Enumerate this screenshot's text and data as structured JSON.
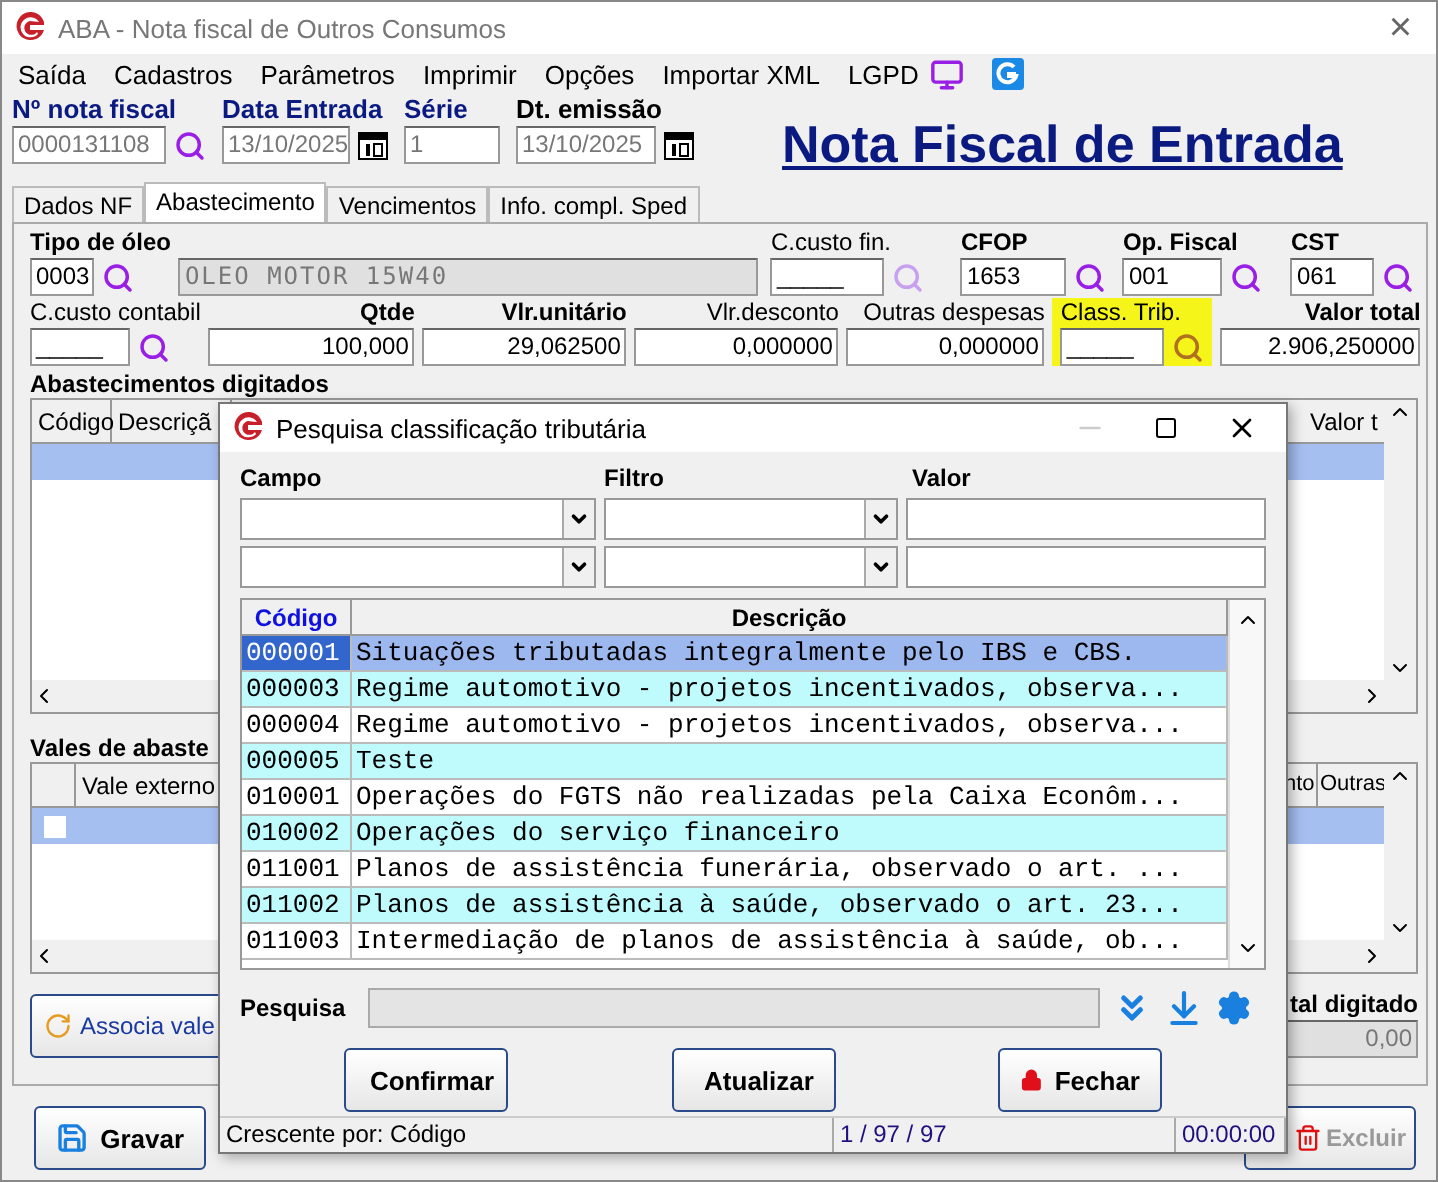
{
  "window": {
    "title": "ABA - Nota fiscal de Outros Consumos",
    "close": "×"
  },
  "menu": [
    "Saída",
    "Cadastros",
    "Parâmetros",
    "Imprimir",
    "Opções",
    "Importar XML",
    "LGPD"
  ],
  "header_fields": [
    {
      "label": "Nº nota fiscal",
      "value": "0000131108",
      "kind": "search"
    },
    {
      "label": "Data Entrada",
      "value": "13/10/2025",
      "kind": "date"
    },
    {
      "label": "Série",
      "value": "1",
      "kind": "plain"
    },
    {
      "label": "Dt. emissão",
      "value": "13/10/2025",
      "kind": "date"
    }
  ],
  "page_heading": "Nota Fiscal de Entrada",
  "tabs": [
    {
      "label": "Dados NF",
      "selected": false
    },
    {
      "label": "Abastecimento",
      "selected": true
    },
    {
      "label": "Vencimentos",
      "selected": false
    },
    {
      "label": "Info. compl. Sped",
      "selected": false
    }
  ],
  "oil_row": [
    {
      "label": "Tipo de óleo",
      "value": "0003",
      "bold": true,
      "kind": "lookup",
      "disabled": false,
      "highlighted": false
    },
    {
      "value": "OLEO MOTOR 15W40",
      "kind": "plain",
      "disabled": true,
      "highlighted": false
    },
    {
      "label": "C.custo fin.",
      "value": "_____",
      "bold": false,
      "kind": "greyed",
      "disabled": false,
      "highlighted": false
    },
    {
      "label": "CFOP",
      "value": "1653",
      "bold": true,
      "kind": "lookup",
      "disabled": false,
      "highlighted": false
    },
    {
      "label": "Op. Fiscal",
      "value": "001",
      "bold": true,
      "kind": "lookup",
      "disabled": false,
      "highlighted": false
    },
    {
      "label": "CST",
      "value": "061",
      "bold": true,
      "kind": "lookup",
      "disabled": false,
      "highlighted": false
    }
  ],
  "value_row": [
    {
      "label": "C.custo contabil",
      "value": "_____",
      "bold": false,
      "kind": "lookup",
      "disabled": false,
      "highlighted": false
    },
    {
      "label": "Qtde",
      "value": "100,000",
      "bold": true,
      "kind": "plain",
      "disabled": false,
      "highlighted": false
    },
    {
      "label": "Vlr.unitário",
      "value": "29,062500",
      "bold": true,
      "kind": "plain",
      "disabled": false,
      "highlighted": false
    },
    {
      "label": "Vlr.desconto",
      "value": "0,000000",
      "bold": false,
      "kind": "plain",
      "disabled": false,
      "highlighted": false
    },
    {
      "label": "Outras despesas",
      "value": "0,000000",
      "bold": false,
      "kind": "plain",
      "disabled": false,
      "highlighted": false
    },
    {
      "label": "Class. Trib.",
      "value": "_____",
      "bold": false,
      "kind": "lookup",
      "disabled": false,
      "highlighted": true
    },
    {
      "label": "Valor total",
      "value": "2.906,250000",
      "bold": true,
      "kind": "plain",
      "disabled": false,
      "highlighted": false
    }
  ],
  "fueling_grid": {
    "title": "Abastecimentos digitados",
    "columns": [
      "Código",
      "Descriçã"
    ],
    "right_column": "Valor t"
  },
  "vouchers_grid": {
    "title": "Vales de abaste",
    "columns": [
      "Vale externo"
    ],
    "right_columns": [
      "nto",
      "Outras"
    ],
    "row_checked": false
  },
  "associate_button": "Associa vale",
  "total": {
    "label": "tal digitado",
    "value": "0,00"
  },
  "bottom_buttons": [
    {
      "label": "Gravar",
      "kind": "save",
      "disabled": false
    },
    {
      "label": "Excluir",
      "kind": "delete",
      "disabled": true
    }
  ],
  "dialog": {
    "title": "Pesquisa classificação tributária",
    "filter_headers": [
      "Campo",
      "Filtro",
      "Valor"
    ],
    "columns": [
      "Código",
      "Descrição"
    ],
    "rows": [
      {
        "code": "000001",
        "description": "Situações tributadas integralmente pelo IBS e CBS.",
        "selected": true
      },
      {
        "code": "000003",
        "description": "Regime automotivo - projetos incentivados, observa...",
        "selected": false
      },
      {
        "code": "000004",
        "description": "Regime automotivo - projetos incentivados, observa...",
        "selected": false
      },
      {
        "code": "000005",
        "description": "Teste",
        "selected": false
      },
      {
        "code": "010001",
        "description": "Operações do FGTS não realizadas pela Caixa Econôm...",
        "selected": false
      },
      {
        "code": "010002",
        "description": "Operações do serviço financeiro",
        "selected": false
      },
      {
        "code": "011001",
        "description": "Planos de assistência funerária, observado o art. ...",
        "selected": false
      },
      {
        "code": "011002",
        "description": "Planos de assistência à saúde, observado o art. 23...",
        "selected": false
      },
      {
        "code": "011003",
        "description": "Intermediação de planos de assistência à saúde, ob...",
        "selected": false
      }
    ],
    "search_label": "Pesquisa",
    "buttons": [
      {
        "label": "Confirmar",
        "kind": "confirm"
      },
      {
        "label": "Atualizar",
        "kind": "refresh"
      },
      {
        "label": "Fechar",
        "kind": "close"
      }
    ],
    "status": [
      "Crescente por: Código",
      "1 / 97 / 97",
      "00:00:00"
    ]
  }
}
